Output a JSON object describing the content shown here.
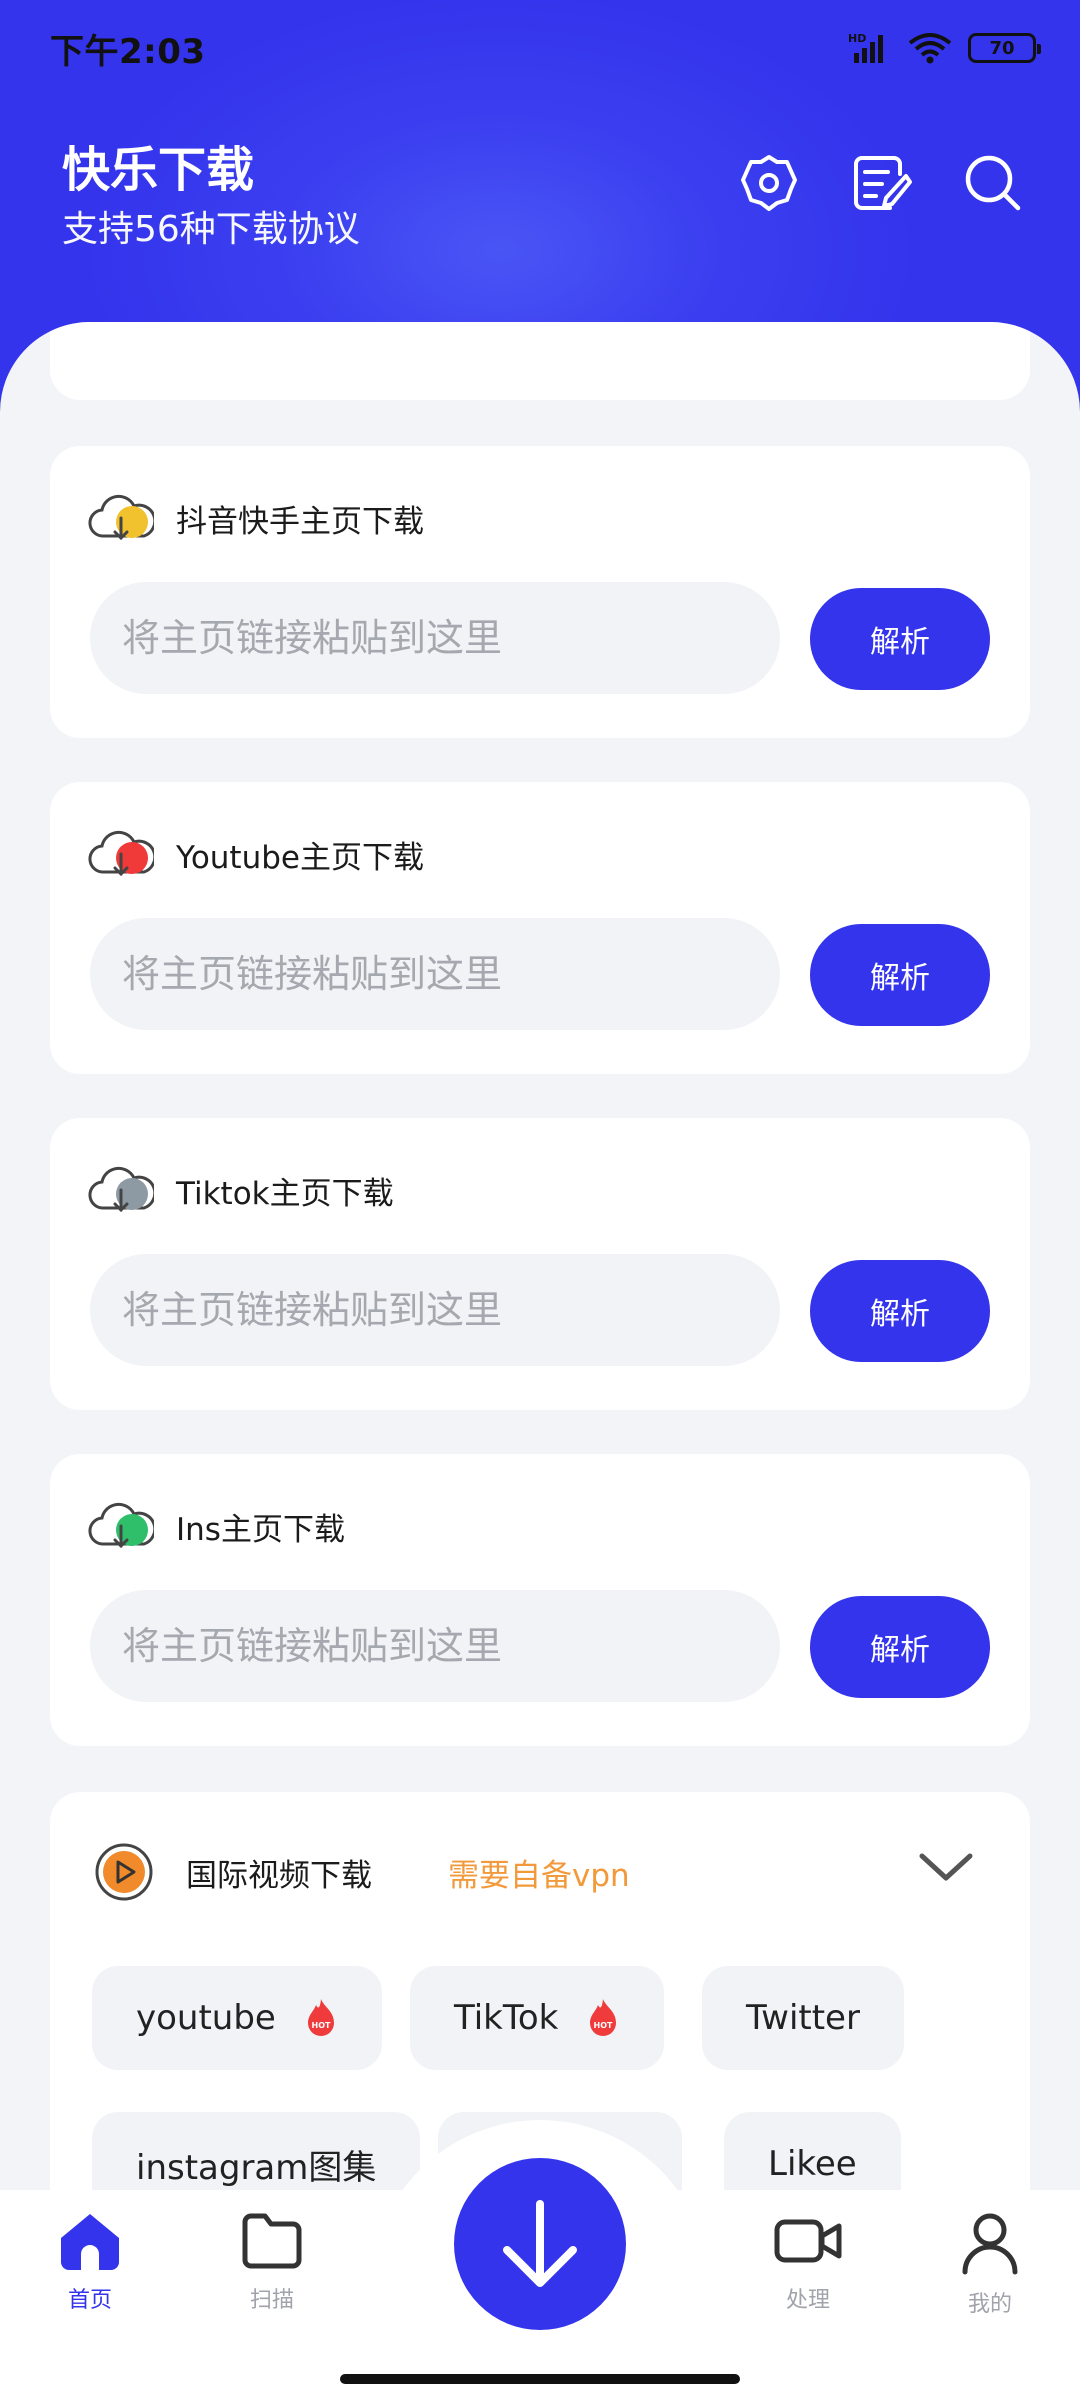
{
  "status_bar": {
    "time": "下午2:03",
    "battery": "70",
    "network": "HD"
  },
  "header": {
    "title": "快乐下载",
    "subtitle": "支持56种下载协议",
    "icons": [
      "settings-icon",
      "notes-icon",
      "search-icon"
    ]
  },
  "cards": [
    {
      "title": "抖音快手主页下载",
      "placeholder": "将主页链接粘贴到这里",
      "button": "解析",
      "icon_color": "#f2c12e"
    },
    {
      "title": "Youtube主页下载",
      "placeholder": "将主页链接粘贴到这里",
      "button": "解析",
      "icon_color": "#f03a3a"
    },
    {
      "title": "Tiktok主页下载",
      "placeholder": "将主页链接粘贴到这里",
      "button": "解析",
      "icon_color": "#8e9aa3"
    },
    {
      "title": "Ins主页下载",
      "placeholder": "将主页链接粘贴到这里",
      "button": "解析",
      "icon_color": "#2fbf6a"
    }
  ],
  "intl": {
    "title": "国际视频下载",
    "note": "需要自备vpn",
    "chips": [
      {
        "label": "youtube",
        "hot": "HOT"
      },
      {
        "label": "TikTok",
        "hot": "HOT"
      },
      {
        "label": "Twitter",
        "hot": ""
      },
      {
        "label": "instagram图集",
        "hot": ""
      },
      {
        "label": "",
        "hot": ""
      },
      {
        "label": "Likee",
        "hot": ""
      }
    ]
  },
  "nav": {
    "items": [
      {
        "label": "首页",
        "icon": "home-icon"
      },
      {
        "label": "扫描",
        "icon": "folder-icon"
      },
      {
        "label": "处理",
        "icon": "video-icon"
      },
      {
        "label": "我的",
        "icon": "profile-icon"
      }
    ],
    "fab_icon": "download-icon"
  },
  "colors": {
    "primary": "#3434ec",
    "accent_orange": "#f29a3b",
    "background": "#f2f4f7"
  }
}
